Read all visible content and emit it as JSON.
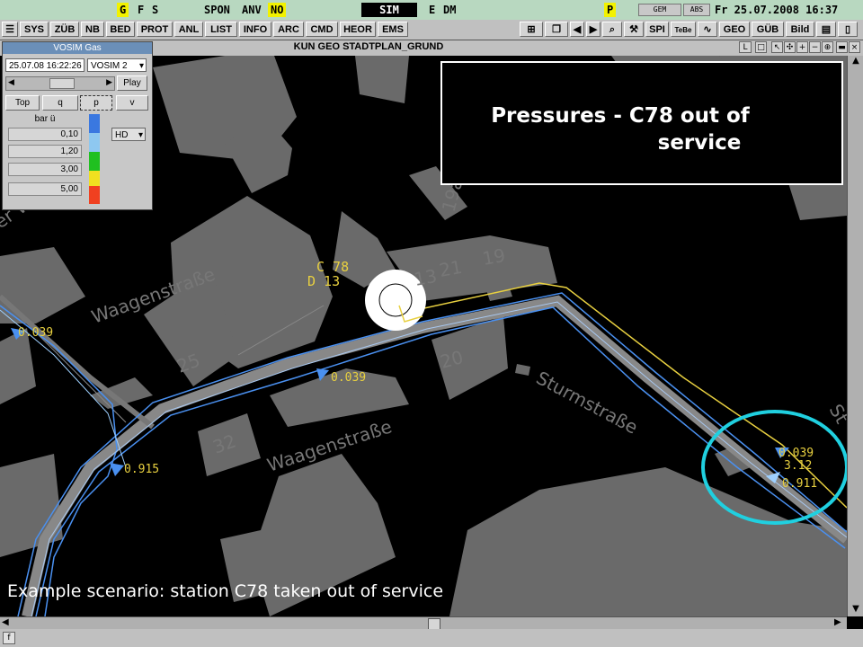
{
  "statusbar": {
    "items": [
      "G",
      "F",
      "S",
      "SPON",
      "ANV",
      "NO",
      "SIM",
      "E",
      "DM",
      "P",
      "GEM",
      "ABS"
    ],
    "datetime": "Fr 25.07.2008 16:37"
  },
  "toolbar": {
    "buttons": [
      "SYS",
      "ZÜB",
      "NB",
      "BED",
      "PROT",
      "ANL",
      "LIST",
      "INFO",
      "ARC",
      "CMD",
      "HEOR",
      "EMS",
      "SPI",
      "TeBe",
      "GEO",
      "GÜB",
      "Bild"
    ]
  },
  "window": {
    "title": "KUN GEO STADTPLAN_GRUND",
    "right_label": "L"
  },
  "vosim": {
    "title": "VOSIM Gas",
    "datetime_field": "25.07.08 16:22:26",
    "mode_select": "VOSIM 2",
    "play_label": "Play",
    "buttons": [
      "Top",
      "q",
      "p",
      "v"
    ],
    "unit_label": "bar ü",
    "values": [
      "0,10",
      "1,20",
      "3,00",
      "5,00"
    ],
    "hd_select": "HD",
    "colors": [
      "#3a78e0",
      "#8ec8f0",
      "#20c020",
      "#f0e020",
      "#f04020"
    ]
  },
  "overlay": {
    "line1": "Pressures - C78 out of",
    "line2": "service"
  },
  "caption": "Example scenario: station C78 taken out of service",
  "map": {
    "streets": [
      "Waagenstraße",
      "Waagenstraße",
      "Sturmstraße",
      "er Weg"
    ],
    "house_numbers": [
      "25",
      "20",
      "32",
      "19",
      "21",
      "13",
      "34",
      "19a",
      "St"
    ],
    "station_labels": [
      "C 78",
      "D 13"
    ],
    "flow_labels": [
      "0.039",
      "0.039",
      "0.915",
      "0.039",
      "3.12",
      "0.911"
    ]
  }
}
